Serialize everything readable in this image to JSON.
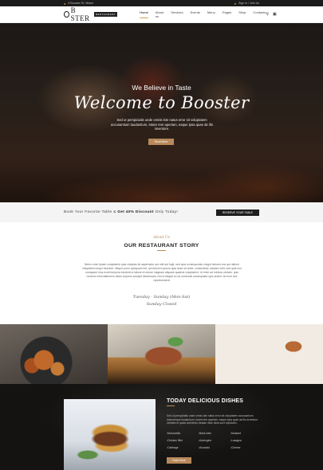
{
  "topbar": {
    "contact": "8 Booster St, Miami",
    "account": "Sign in / Join Us"
  },
  "header": {
    "logo_text": "B  STER",
    "logo_tag": "RESTAURANT",
    "nav": [
      "Home",
      "About us",
      "Services",
      "Events",
      "Menu",
      "Pages",
      "Shop",
      "Contacts"
    ]
  },
  "hero": {
    "subtitle": "We Believe in Taste",
    "title": "Welcome to Booster",
    "text": "Sed ut perspiciatis unde omnis iste natus error sit voluptatem accusantium laudantium, totam rem aperiam, eaque ipsa quae ab illo inventore.",
    "button": "Read More"
  },
  "booking": {
    "text_prefix": "Book Your Favorite Table & ",
    "text_bold": "Get 40% Discount",
    "text_suffix": " Only Today!",
    "button": "RESERVE YOUR TABLE"
  },
  "story": {
    "about": "About Us",
    "title": "OUR RESTAURANT STORY",
    "body": "Nemo enim ipsam voluptatem quia voluptas sit aspernatur aut odit aut fugit, sed quia consequuntur magni dolores eos qui ratione voluptatem sequi nesciunt. Neque porro quisquam est, qui dolorem ipsum quia dolor sit amet, consectetur, adipisci velit, sed quia non numquam eius modi tempora incidunt ut labore et dolore magnam aliquam quaerat voluptatem. Ut enim ad minima veniam, quis nostrum exercitationem ullam corporis suscipit laboriosam, nisi ut aliquid ex ea commodi consequatur quis autem vel eum iure reprehenderit.",
    "sig_line1": "Tuesday - Sunday (Mon-Sat)",
    "sig_line2": "Sunday Closed"
  },
  "dishes": {
    "heading": "TODAY DELICIOUS DISHES",
    "text": "Sed ut perspiciatis unde omnis iste natus error sit voluptatem accusantium doloremque laudantium, totam rem aperiam, eaque ipsa quae ab illo inventore veritatis et quasi architecto beatae vitae dicta sunt explicabo.",
    "items": [
      "Mozzarella",
      "Basil olive",
      "Mustard",
      "Chicken fillet",
      "Aubergine",
      "Lasagna",
      "Cabbage",
      "Avocado",
      "Cheese"
    ],
    "button": "Read More"
  },
  "colors": {
    "accent": "#b8895a",
    "dark": "#1e1e1e"
  }
}
